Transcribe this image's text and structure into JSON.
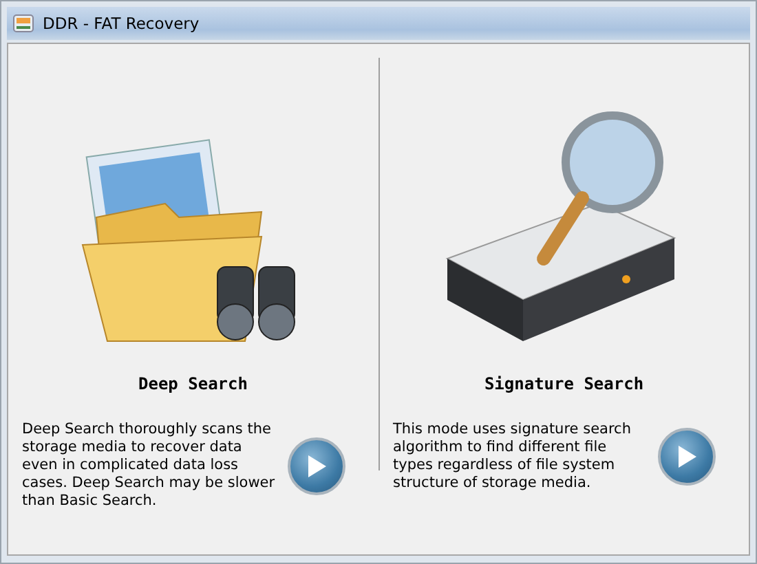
{
  "window": {
    "title": "DDR - FAT Recovery"
  },
  "modes": [
    {
      "kind": "deep",
      "title": "Deep Search",
      "description": "Deep Search thoroughly scans the storage media to recover data even in complicated data loss cases. Deep Search may be slower than Basic Search."
    },
    {
      "kind": "signature",
      "title": "Signature Search",
      "description": "This mode uses signature search algorithm to find different file types regardless of file system structure of storage media."
    }
  ]
}
